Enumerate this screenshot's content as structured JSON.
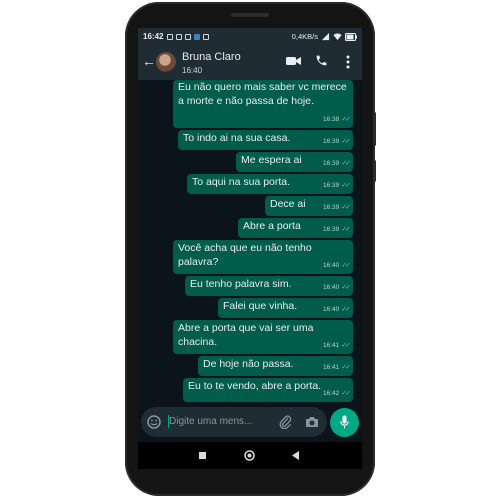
{
  "status_bar": {
    "time": "16:42",
    "speed": "0,4KB/s",
    "battery": "77"
  },
  "header": {
    "contact_name": "Bruna Claro",
    "last_seen": "16:40"
  },
  "messages": [
    {
      "text": "Eu não quero mais saber vc merece a morte e não passa de hoje.",
      "time": "16:38"
    },
    {
      "text": "To indo ai na sua casa.",
      "time": "16:39"
    },
    {
      "text": "Me espera ai",
      "time": "16:39"
    },
    {
      "text": "To aqui na sua porta.",
      "time": "16:39"
    },
    {
      "text": "Dece ai",
      "time": "16:39"
    },
    {
      "text": "Abre a porta",
      "time": "16:39"
    },
    {
      "text": "Você acha que eu não tenho palavra?",
      "time": "16:40"
    },
    {
      "text": "Eu tenho palavra sim.",
      "time": "16:40"
    },
    {
      "text": "Falei que vinha.",
      "time": "16:40"
    },
    {
      "text": "Abre a porta que vai ser uma chacina.",
      "time": "16:41"
    },
    {
      "text": "De hoje não passa.",
      "time": "16:41"
    },
    {
      "text": "Eu to te vendo, abre a porta.",
      "time": "16:42"
    }
  ],
  "composer": {
    "placeholder": "Digite uma mens..."
  },
  "colors": {
    "app_bar": "#1f2c34",
    "chat_bg": "#0b141a",
    "outgoing_bubble": "#005c4b",
    "accent": "#00a884",
    "read_ticks": "#53bdeb"
  },
  "icons": [
    "back-arrow-icon",
    "video-call-icon",
    "phone-icon",
    "more-vert-icon",
    "emoji-icon",
    "attach-icon",
    "camera-icon",
    "mic-icon",
    "nav-square-icon",
    "nav-home-icon",
    "nav-back-icon"
  ]
}
